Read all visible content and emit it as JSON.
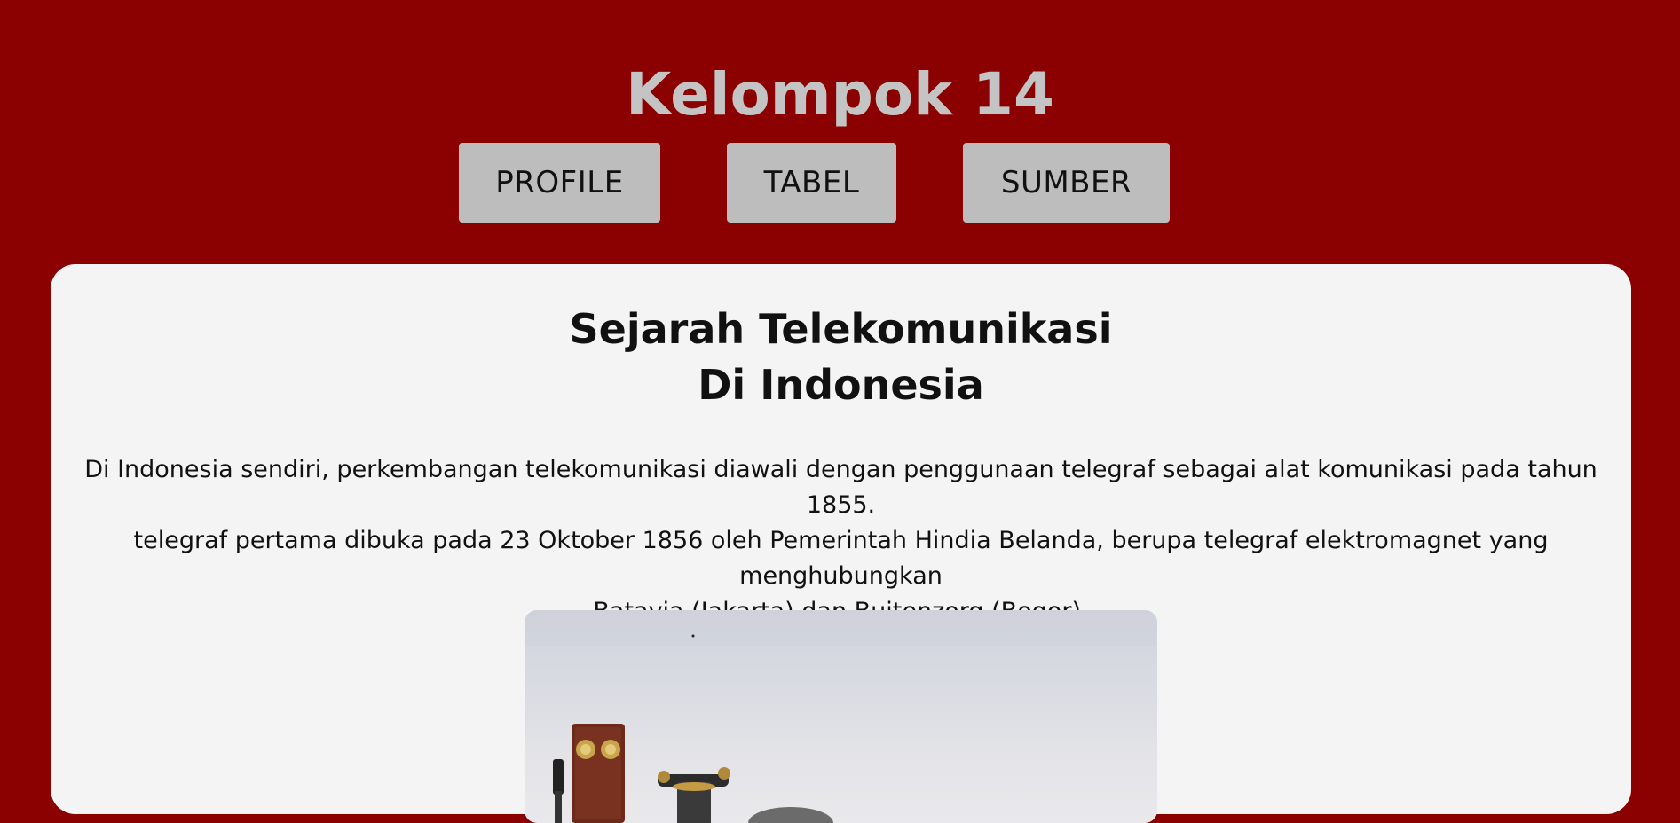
{
  "header": {
    "title": "Kelompok 14",
    "nav": [
      {
        "label": "PROFILE"
      },
      {
        "label": "TABEL"
      },
      {
        "label": "SUMBER"
      }
    ]
  },
  "article": {
    "title_line1": "Sejarah Telekomunikasi",
    "title_line2": "Di Indonesia",
    "body": "Di Indonesia sendiri, perkembangan telekomunikasi diawali dengan penggunaan telegraf sebagai alat komunikasi pada tahun 1855.\ntelegraf pertama dibuka pada 23 Oktober 1856 oleh Pemerintah Hindia Belanda, berupa telegraf elektromagnet yang menghubungkan\nBatavia (Jakarta) dan Buitenzorg (Bogor).",
    "image_subject": "antique-telephones"
  },
  "colors": {
    "background": "#8b0000",
    "title": "#c4c4c4",
    "button": "#bdbdbd",
    "card": "#f4f4f4"
  }
}
